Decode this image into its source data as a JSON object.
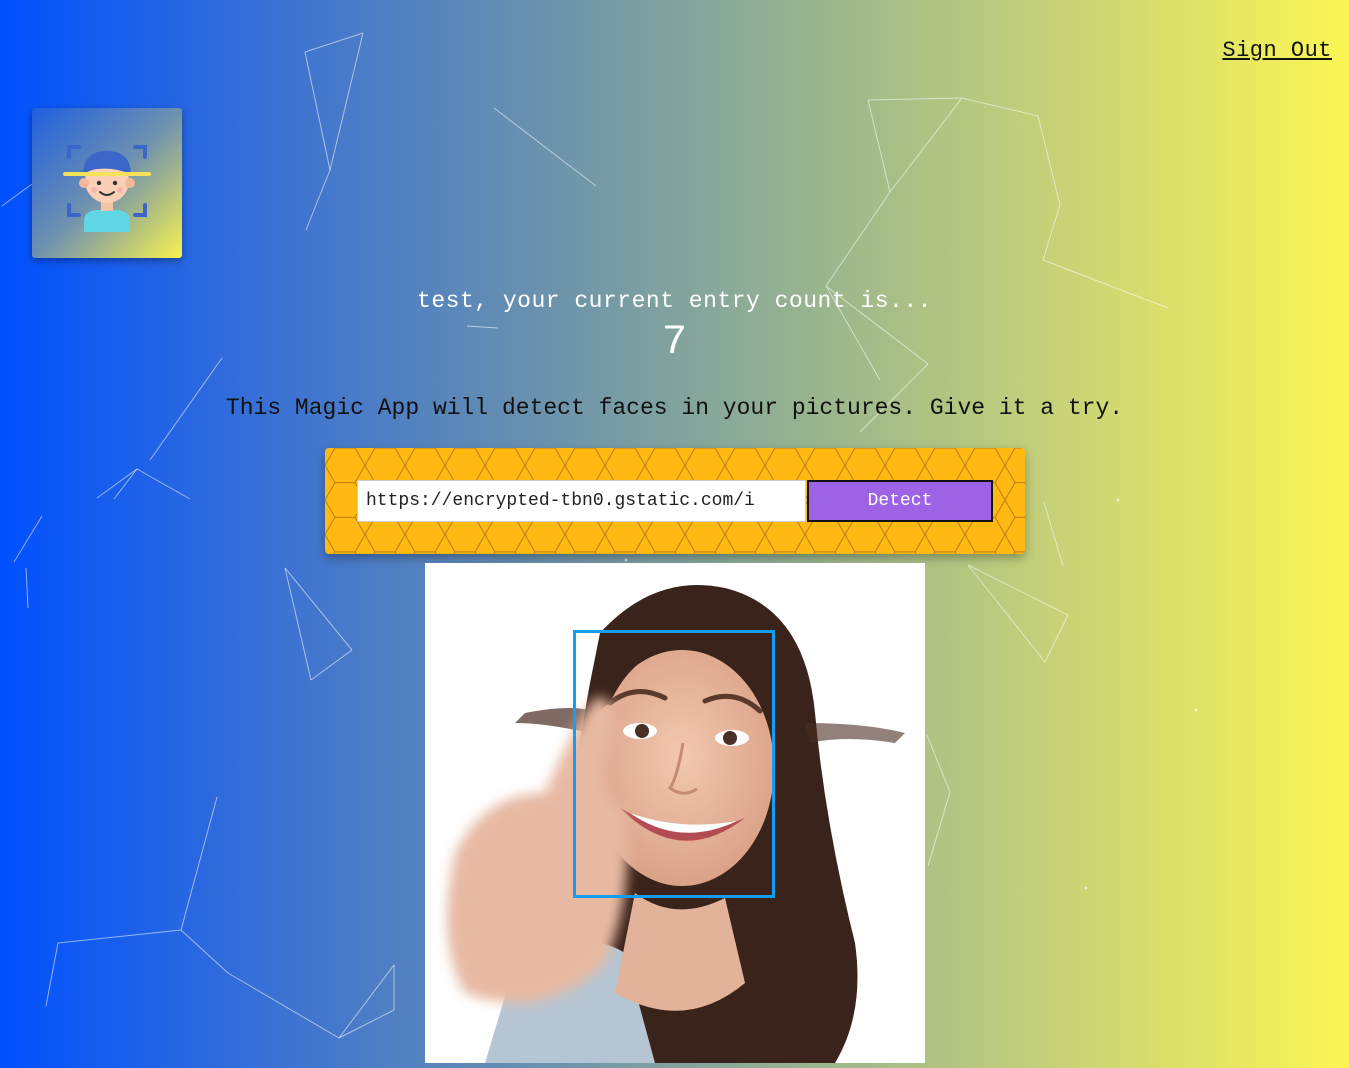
{
  "nav": {
    "sign_out_label": "Sign Out"
  },
  "logo": {
    "icon": "face-scan-icon"
  },
  "rank": {
    "greeting": "test, your current entry count is...",
    "count": "7"
  },
  "tagline": "This Magic App will detect faces in your pictures. Give it a try.",
  "form": {
    "url_value": "https://encrypted-tbn0.gstatic.com/i",
    "detect_label": "Detect"
  },
  "result": {
    "image": "smiling-woman-thumbs-up-photo",
    "face_box_color": "#149df2"
  },
  "colors": {
    "gradient_start": "#0050ff",
    "gradient_end": "#fbf653",
    "panel": "#ffb912",
    "button": "#9d63e4"
  }
}
